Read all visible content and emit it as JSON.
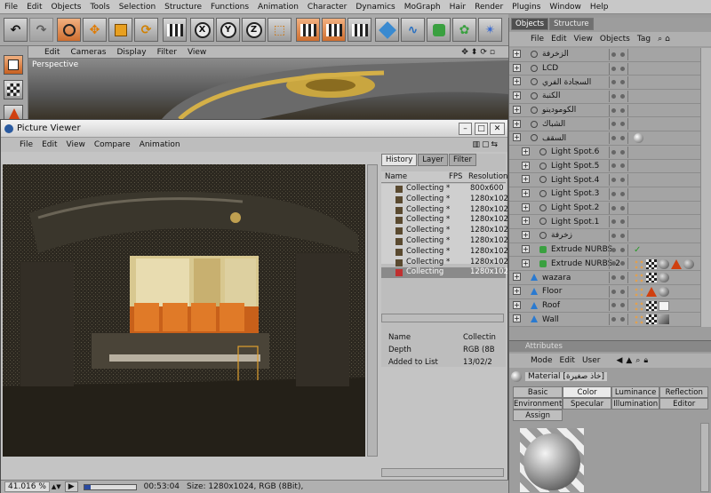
{
  "menubar": [
    "File",
    "Edit",
    "Objects",
    "Tools",
    "Selection",
    "Structure",
    "Functions",
    "Animation",
    "Character",
    "Dynamics",
    "MoGraph",
    "Hair",
    "Render",
    "Plugins",
    "Window",
    "Help"
  ],
  "viewport": {
    "menu": [
      "Edit",
      "Cameras",
      "Display",
      "Filter",
      "View"
    ],
    "label": "Perspective"
  },
  "toolbar": {
    "x": "X",
    "y": "Y",
    "z": "Z"
  },
  "picture_viewer": {
    "title": "Picture Viewer",
    "menu": [
      "File",
      "Edit",
      "View",
      "Compare",
      "Animation"
    ],
    "tabs": [
      "History",
      "Layer",
      "Filter"
    ],
    "columns": [
      "Name",
      "FPS",
      "Resolution"
    ],
    "rows": [
      {
        "name": "Collecting *",
        "res": "800x600"
      },
      {
        "name": "Collecting *",
        "res": "1280x102"
      },
      {
        "name": "Collecting *",
        "res": "1280x102"
      },
      {
        "name": "Collecting *",
        "res": "1280x102"
      },
      {
        "name": "Collecting *",
        "res": "1280x102"
      },
      {
        "name": "Collecting *",
        "res": "1280x102"
      },
      {
        "name": "Collecting *",
        "res": "1280x102"
      },
      {
        "name": "Collecting *",
        "res": "1280x102"
      },
      {
        "name": "Collecting",
        "res": "1280x102"
      }
    ],
    "info": [
      {
        "k": "Name",
        "v": "Collectin"
      },
      {
        "k": "Depth",
        "v": "RGB (8B"
      },
      {
        "k": "Added to List",
        "v": "13/02/2"
      }
    ],
    "status": {
      "zoom": "41.016 %",
      "time": "00:53:04",
      "size": "Size: 1280x1024, RGB (8Bit),"
    }
  },
  "objects": {
    "tabs": [
      "Objects",
      "Structure"
    ],
    "menu": [
      "File",
      "Edit",
      "View",
      "Objects",
      "Tag"
    ],
    "rows": [
      "الزخرفة",
      "LCD",
      "السجادة الفري",
      "الكنبة",
      "الكومودينو",
      "الشباك",
      "السقف",
      "Light Spot.6",
      "Light Spot.5",
      "Light Spot.4",
      "Light Spot.3",
      "Light Spot.2",
      "Light Spot.1",
      "زخرفة",
      "Extrude NURBS",
      "Extrude NURBS.2",
      "wazara",
      "Floor",
      "Roof",
      "Wall"
    ]
  },
  "attributes": {
    "title": "Attributes",
    "menu": [
      "Mode",
      "Edit",
      "User"
    ],
    "material": "Material [خاذ صغيرة]",
    "tabs": [
      "Basic",
      "Color",
      "Luminance",
      "Reflection",
      "Environment",
      "Specular",
      "Illumination",
      "Editor",
      "Assign"
    ]
  }
}
